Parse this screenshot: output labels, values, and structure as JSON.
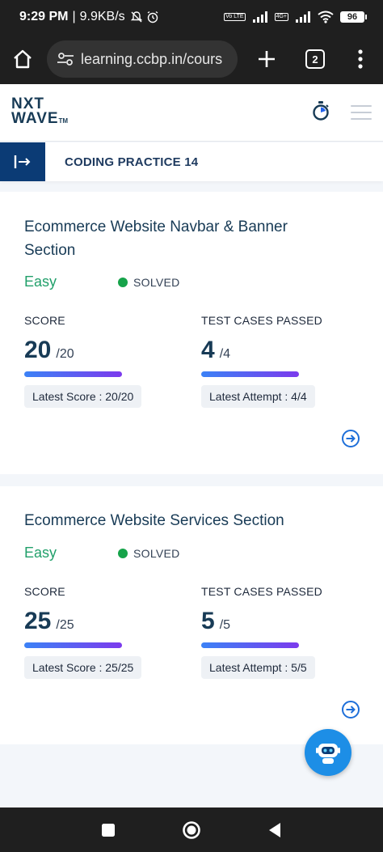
{
  "status_bar": {
    "time": "9:29 PM",
    "network_speed": "9.9KB/s",
    "battery": "96",
    "lte_badge": "Vo LTE",
    "signal_badge": "4G+"
  },
  "browser": {
    "url": "learning.ccbp.in/cours",
    "tab_count": "2"
  },
  "header": {
    "logo_line1": "NXT",
    "logo_line2": "WAVE",
    "logo_tm": "TM"
  },
  "subheader": {
    "title": "CODING PRACTICE 14"
  },
  "questions": [
    {
      "title": "Ecommerce Website Navbar & Banner Section",
      "difficulty": "Easy",
      "status": "SOLVED",
      "score_label": "SCORE",
      "score": "20",
      "score_total": "/20",
      "score_fraction": 1.0,
      "score_chip": "Latest Score : 20/20",
      "tests_label": "TEST CASES PASSED",
      "tests": "4",
      "tests_total": "/4",
      "tests_fraction": 1.0,
      "tests_chip": "Latest Attempt : 4/4"
    },
    {
      "title": "Ecommerce Website Services Section",
      "difficulty": "Easy",
      "status": "SOLVED",
      "score_label": "SCORE",
      "score": "25",
      "score_total": "/25",
      "score_fraction": 1.0,
      "score_chip": "Latest Score : 25/25",
      "tests_label": "TEST CASES PASSED",
      "tests": "5",
      "tests_total": "/5",
      "tests_fraction": 1.0,
      "tests_chip": "Latest Attempt : 5/5"
    }
  ],
  "colors": {
    "brand_navy": "#0b3b75",
    "easy_green": "#22a06b",
    "solved_dot": "#16a34a",
    "progress_start": "#3b82f6",
    "progress_end": "#7c3aed",
    "chatbot_blue": "#1d8ee6"
  },
  "icons": {
    "home": "home-icon",
    "site_settings": "tune-icon",
    "new_tab": "plus-icon",
    "tabs": "tab-switcher-icon",
    "menu": "more-vert-icon",
    "timer": "stopwatch-icon",
    "hamburger": "hamburger-icon",
    "sidebar_toggle": "sidebar-expand-icon",
    "open_question": "arrow-circle-right-icon",
    "chatbot": "robot-icon",
    "nav_recents": "square-icon",
    "nav_home": "circle-icon",
    "nav_back": "triangle-back-icon"
  }
}
